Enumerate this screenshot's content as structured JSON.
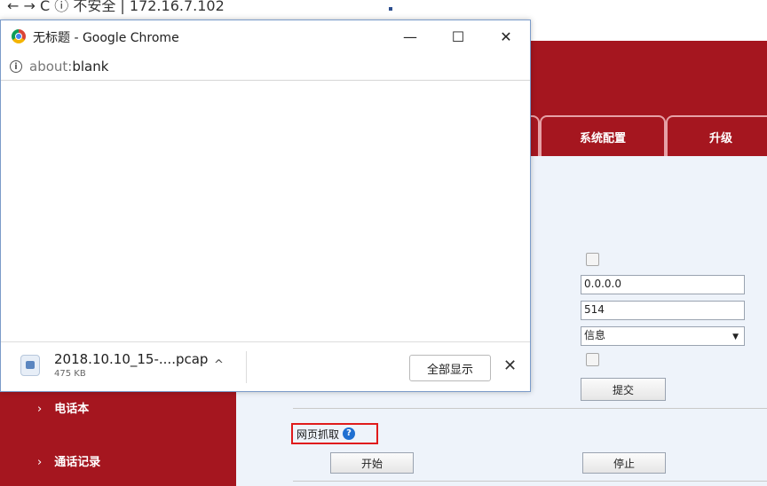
{
  "background_browser": {
    "tab_strip_text": "←  →  C  ⓘ 不安全  |  172.16.7.102"
  },
  "app": {
    "nav_tabs": [
      {
        "label": "系统配置"
      },
      {
        "label": "升级"
      }
    ],
    "syslog": {
      "server_ip": "0.0.0.0",
      "port": "514",
      "level": "信息",
      "submit_label": "提交"
    },
    "sidebar": {
      "items": [
        {
          "label": "电话本"
        },
        {
          "label": "通话记录"
        }
      ]
    },
    "capture": {
      "title": "网页抓取",
      "help_glyph": "?",
      "start_label": "开始",
      "stop_label": "停止"
    }
  },
  "popup": {
    "title": "无标题 - Google Chrome",
    "minimize_glyph": "—",
    "maximize_glyph": "☐",
    "close_glyph": "✕",
    "info_glyph": "i",
    "url_scheme": "about:",
    "url_path": "blank",
    "download": {
      "file_name": "2018.10.10_15-....pcap",
      "file_size": "475 KB",
      "caret": "^",
      "show_all_label": "全部显示",
      "close_glyph": "✕"
    }
  },
  "colors": {
    "brand_red": "#a5161f",
    "highlight_box": "#e01b1b",
    "help_blue": "#1f6fd1"
  }
}
